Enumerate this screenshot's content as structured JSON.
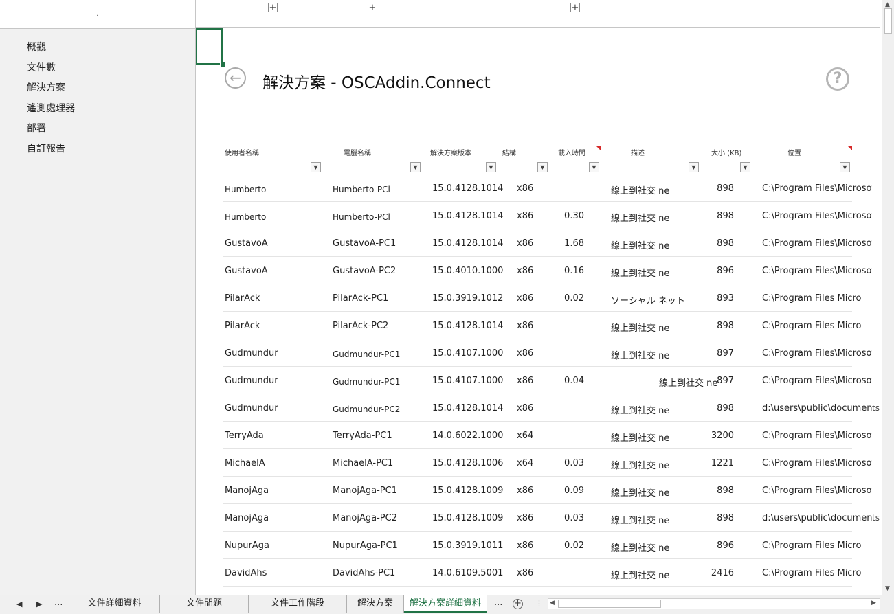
{
  "nav": {
    "dot": ".",
    "items": [
      {
        "label": "概觀"
      },
      {
        "label": "文件數"
      },
      {
        "label": "解決方案"
      },
      {
        "label": "遙測處理器"
      },
      {
        "label": "部署"
      },
      {
        "label": "自訂報告"
      }
    ]
  },
  "toolbar": {
    "expand_glyph": "+"
  },
  "header": {
    "back_glyph": "←",
    "title": "解決方案 - OSCAddin.Connect",
    "help_glyph": "?"
  },
  "table": {
    "filter_glyph": "▼",
    "columns": [
      {
        "key": "user",
        "label": "使用者名稱"
      },
      {
        "key": "pc",
        "label": "電腦名稱"
      },
      {
        "key": "version",
        "label": "解決方案版本"
      },
      {
        "key": "arch",
        "label": "結構"
      },
      {
        "key": "load",
        "label": "載入時間"
      },
      {
        "key": "desc",
        "label": "描述"
      },
      {
        "key": "size",
        "label": "大小 (KB)"
      },
      {
        "key": "location",
        "label": "位置"
      }
    ],
    "rows": [
      {
        "user": "Humberto",
        "pc": "Humberto-PCl",
        "version": "15.0.4128.1014",
        "arch": "x86",
        "load": "",
        "desc": "線上到社交 ne",
        "size": "898",
        "location": "C:\\Program Files\\Microsoft",
        "tail": ""
      },
      {
        "user": "Humberto",
        "pc": "Humberto-PCl",
        "version": "15.0.4128.1014",
        "arch": "x86",
        "load": "0.30",
        "desc": "線上到社交 ne",
        "size": "898",
        "location": "C:\\Program Files\\Microsoft",
        "tail": ""
      },
      {
        "user": "GustavoA",
        "pc": "GustavoA-PC1",
        "version": "15.0.4128.1014",
        "arch": "x86",
        "load": "1.68",
        "desc": "線上到社交 ne",
        "size": "898",
        "location": "C:\\Program Files\\Microsoft",
        "tail": ""
      },
      {
        "user": "GustavoA",
        "pc": "GustavoA-PC2",
        "version": "15.0.4010.1000",
        "arch": "x86",
        "load": "0.16",
        "desc": "線上到社交 ne",
        "size": "896",
        "location": "C:\\Program Files\\Microsoft",
        "tail": ""
      },
      {
        "user": "PilarAck",
        "pc": "PilarAck-PC1",
        "version": "15.0.3919.1012",
        "arch": "x86",
        "load": "0.02",
        "desc": "ソーシャル ネット",
        "size": "893",
        "location": "C:\\Program Files Micro",
        "tail": ""
      },
      {
        "user": "PilarAck",
        "pc": "PilarAck-PC2",
        "version": "15.0.4128.1014",
        "arch": "x86",
        "load": "",
        "desc": "線上到社交 ne",
        "size": "898",
        "location": "C:\\Program Files Micro",
        "tail": ""
      },
      {
        "user": "Gudmundur",
        "pc": "Gudmundur-PC1",
        "version": "15.0.4107.1000",
        "arch": "x86",
        "load": "",
        "desc": "線上到社交 ne",
        "size": "897",
        "location": "C:\\Program Files\\Microsoft",
        "tail": ""
      },
      {
        "user": "Gudmundur",
        "pc": "Gudmundur-PC1",
        "version": "15.0.4107.1000",
        "arch": "x86",
        "load": "0.04",
        "desc": "線上到社交 ne",
        "size": "897",
        "location": "C:\\Program Files\\Microsoft",
        "tail": ""
      },
      {
        "user": "Gudmundur",
        "pc": "Gudmundur-PC2",
        "version": "15.0.4128.1014",
        "arch": "x86",
        "load": "",
        "desc": "線上到社交 ne",
        "size": "898",
        "location": "d:\\users\\public\\documen",
        "tail": "ts"
      },
      {
        "user": "TerryAda",
        "pc": "TerryAda-PC1",
        "version": "14.0.6022.1000",
        "arch": "x64",
        "load": "",
        "desc": "線上到社交 ne",
        "size": "3200",
        "location": "C:\\Program Files\\Microsoft",
        "tail": ""
      },
      {
        "user": "MichaelA",
        "pc": "MichaelA-PC1",
        "version": "15.0.4128.1006",
        "arch": "x64",
        "load": "0.03",
        "desc": "線上到社交 ne",
        "size": "1221",
        "location": "C:\\Program Files\\Microsoft",
        "tail": ""
      },
      {
        "user": "ManojAga",
        "pc": "ManojAga-PC1",
        "version": "15.0.4128.1009",
        "arch": "x86",
        "load": "0.09",
        "desc": "線上到社交 ne",
        "size": "898",
        "location": "C:\\Program Files\\Microsoft",
        "tail": ""
      },
      {
        "user": "ManojAga",
        "pc": "ManojAga-PC2",
        "version": "15.0.4128.1009",
        "arch": "x86",
        "load": "0.03",
        "desc": "線上到社交 ne",
        "size": "898",
        "location": "d:\\users\\public\\documen",
        "tail": "ts"
      },
      {
        "user": "NupurAga",
        "pc": "NupurAga-PC1",
        "version": "15.0.3919.1011",
        "arch": "x86",
        "load": "0.02",
        "desc": "線上到社交 ne",
        "size": "896",
        "location": "C:\\Program Files Micro",
        "tail": ""
      },
      {
        "user": "DavidAhs",
        "pc": "DavidAhs-PC1",
        "version": "14.0.6109.5001",
        "arch": "x86",
        "load": "",
        "desc": "線上到社交 ne",
        "size": "2416",
        "location": "C:\\Program Files Micro",
        "tail": ""
      }
    ]
  },
  "tabs": {
    "prev_glyph": "◀",
    "next_glyph": "▶",
    "ellipsis": "...",
    "sheets": [
      {
        "label": "文件詳細資料"
      },
      {
        "label": "文件問題"
      },
      {
        "label": "文件工作階段"
      },
      {
        "label": "解決方案"
      },
      {
        "label": "解決方案詳細資料"
      }
    ],
    "active_index": 4,
    "trailing_ellipsis": "...",
    "add_glyph": "+",
    "split_glyph": "⋮"
  },
  "scrollbars": {
    "up_glyph": "▲",
    "down_glyph": "▼",
    "left_glyph": "◀",
    "right_glyph": "▶"
  },
  "colors": {
    "accent": "#217346",
    "nav_background": "#f1f1f1",
    "comment_marker": "#d62a2a"
  }
}
